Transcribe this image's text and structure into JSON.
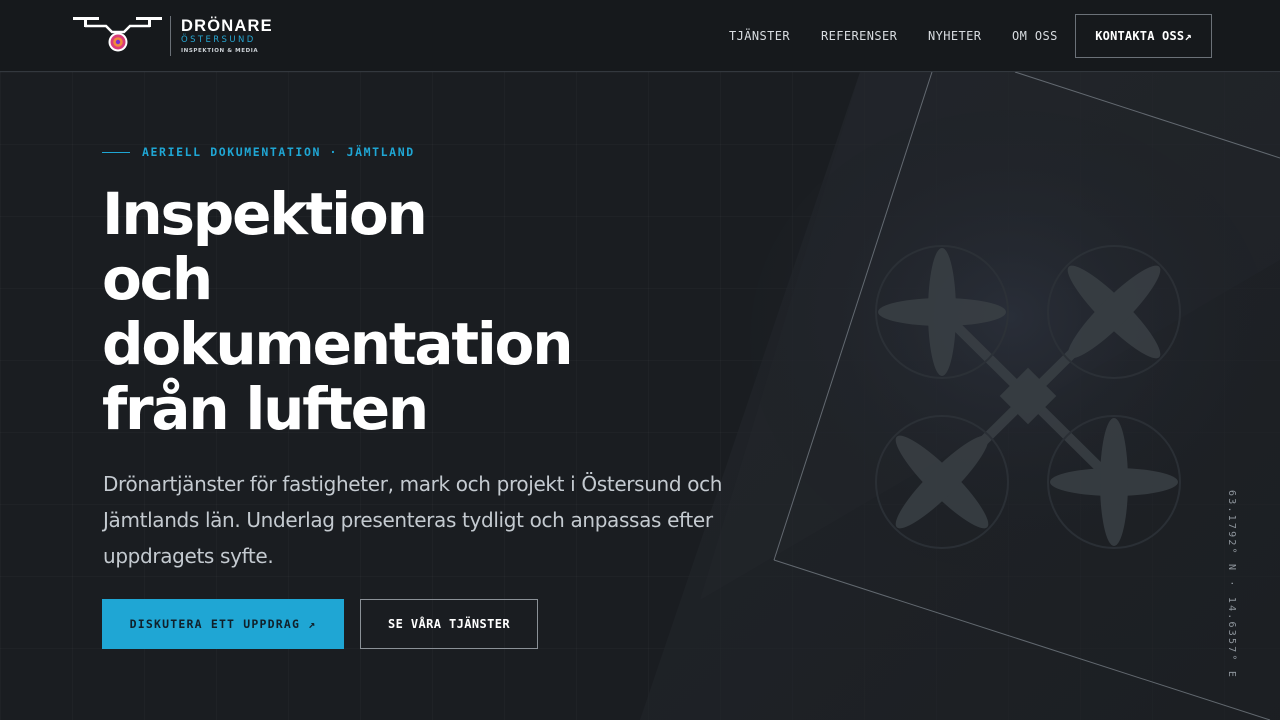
{
  "brand": {
    "name": "DRÖNARE",
    "city": "ÖSTERSUND",
    "tagline": "INSPEKTION & MEDIA",
    "accent": "#1fa6d4"
  },
  "nav": {
    "items": [
      {
        "label": "TJÄNSTER"
      },
      {
        "label": "REFERENSER"
      },
      {
        "label": "NYHETER"
      },
      {
        "label": "OM OSS"
      }
    ],
    "cta": "KONTAKTA OSS↗"
  },
  "hero": {
    "eyebrow": "AERIELL DOKUMENTATION · JÄMTLAND",
    "title_lines": [
      "Inspektion",
      "och",
      "dokumentation",
      "från luften"
    ],
    "lead": "Drönartjänster för fastigheter, mark och projekt i Östersund och Jämtlands län. Underlag presenteras tydligt och anpassas efter uppdragets syfte.",
    "primary_button": "DISKUTERA ETT UPPDRAG ↗",
    "secondary_button": "SE VÅRA TJÄNSTER",
    "coordinates": "63.1792° N · 14.6357° E"
  },
  "colors": {
    "background": "#1a1d21",
    "header": "#16191c",
    "primary_button": "#1fa6d4",
    "text": "#ffffff"
  }
}
